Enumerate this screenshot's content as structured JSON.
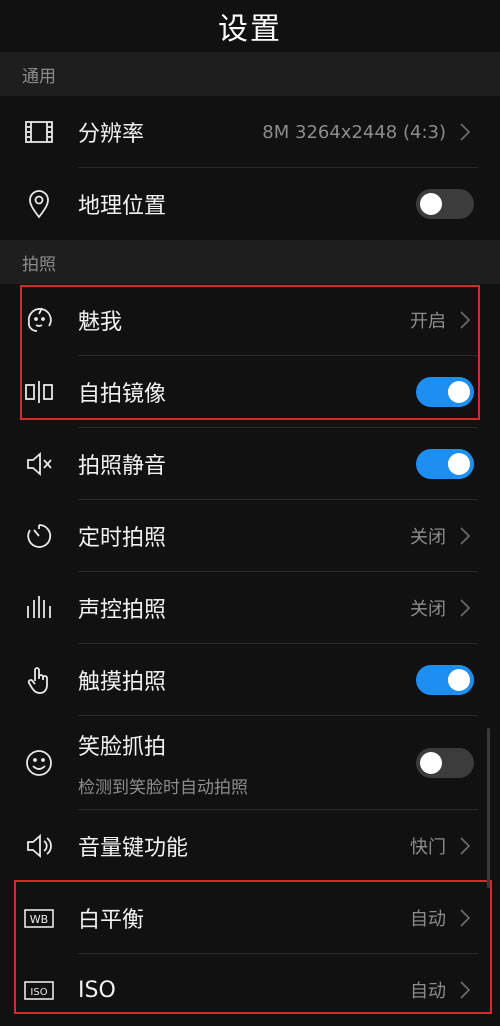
{
  "header": {
    "title": "设置"
  },
  "sections": [
    {
      "title": "通用",
      "items": [
        {
          "label": "分辨率",
          "value": "8M 3264x2448 (4:3)",
          "icon": "resolution-icon",
          "type": "chevron"
        },
        {
          "label": "地理位置",
          "icon": "location-pin-icon",
          "type": "toggle",
          "on": false
        }
      ]
    },
    {
      "title": "拍照",
      "items": [
        {
          "label": "魅我",
          "value": "开启",
          "icon": "beauty-face-icon",
          "type": "chevron"
        },
        {
          "label": "自拍镜像",
          "icon": "mirror-icon",
          "type": "toggle",
          "on": true
        },
        {
          "label": "拍照静音",
          "icon": "mute-speaker-icon",
          "type": "toggle",
          "on": true
        },
        {
          "label": "定时拍照",
          "value": "关闭",
          "icon": "timer-icon",
          "type": "chevron"
        },
        {
          "label": "声控拍照",
          "value": "关闭",
          "icon": "audio-bars-icon",
          "type": "chevron"
        },
        {
          "label": "触摸拍照",
          "icon": "hand-touch-icon",
          "type": "toggle",
          "on": true
        },
        {
          "label": "笑脸抓拍",
          "sub": "检测到笑脸时自动拍照",
          "icon": "smile-icon",
          "type": "toggle",
          "on": false
        },
        {
          "label": "音量键功能",
          "value": "快门",
          "icon": "speaker-icon",
          "type": "chevron"
        },
        {
          "label": "白平衡",
          "value": "自动",
          "icon": "wb-icon",
          "icon_text": "WB",
          "type": "chevron"
        },
        {
          "label": "ISO",
          "value": "自动",
          "icon": "iso-icon",
          "icon_text": "ISO",
          "type": "chevron"
        }
      ]
    }
  ],
  "colors": {
    "accent": "#1e8ff2",
    "highlight": "#d52a2a",
    "background": "#111111",
    "section": "#1e1e1e"
  }
}
